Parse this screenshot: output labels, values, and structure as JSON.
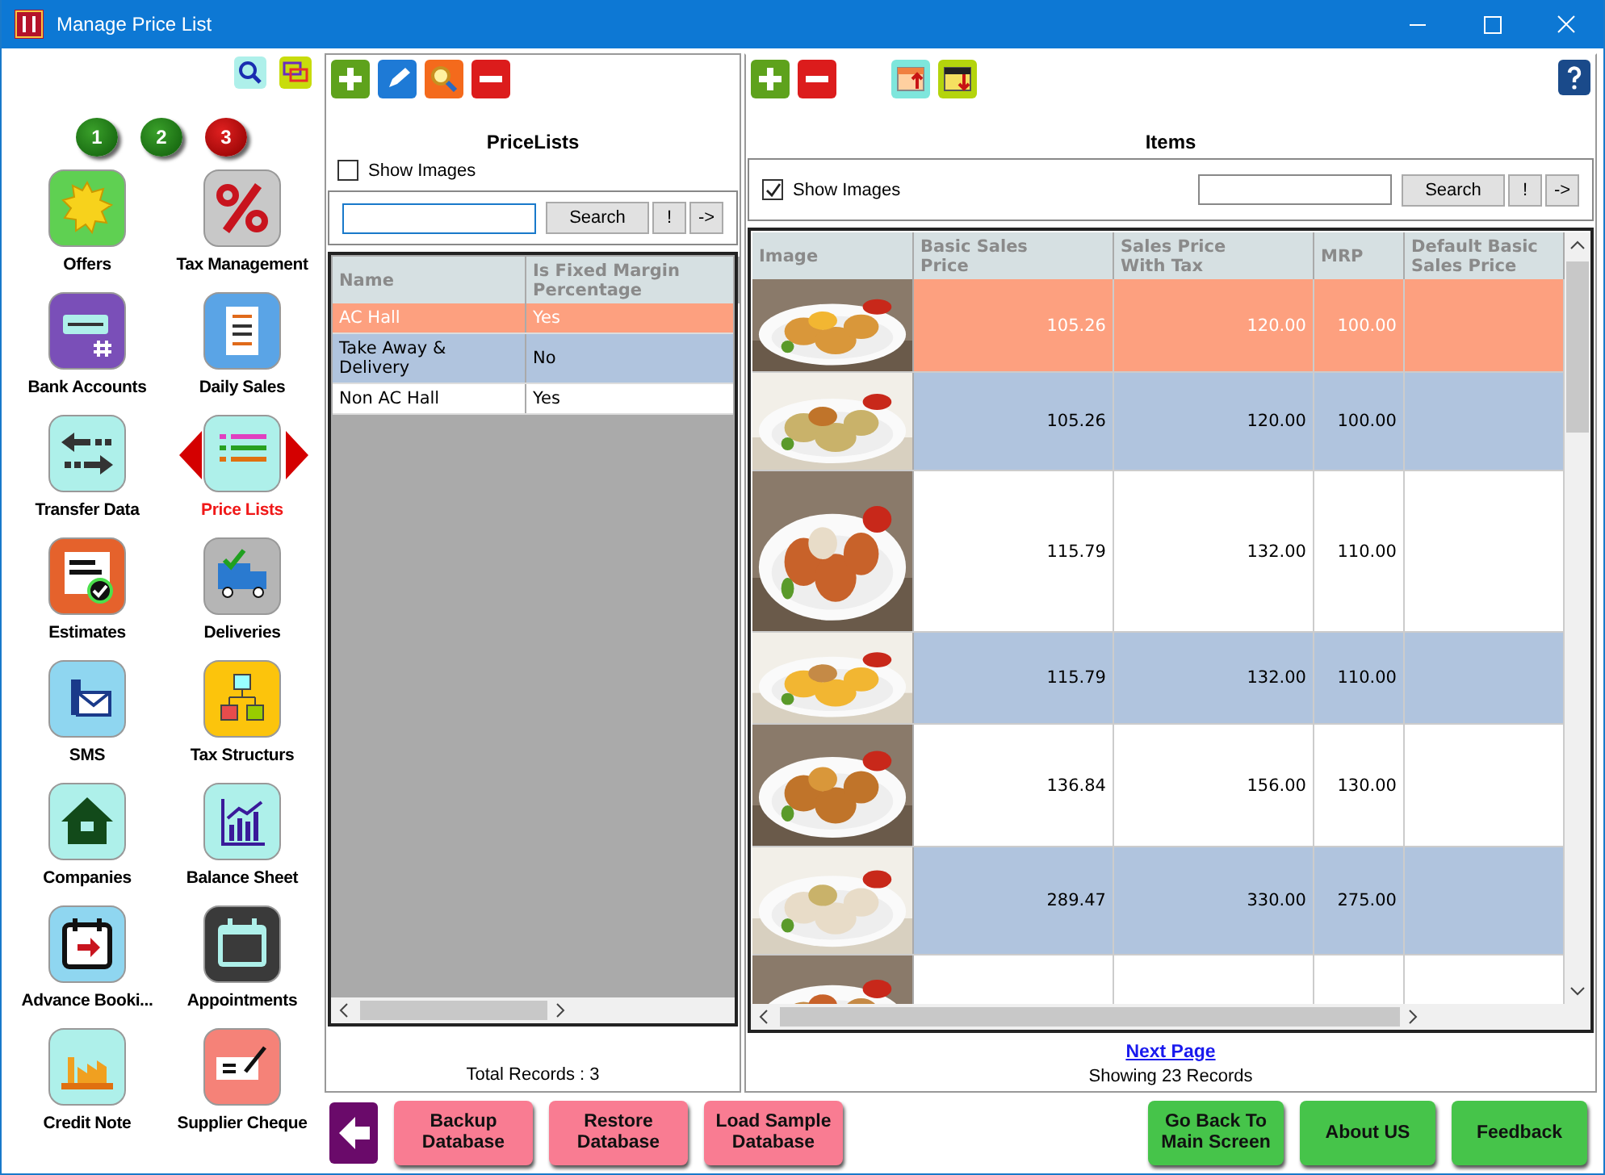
{
  "window": {
    "title": "Manage Price List"
  },
  "sidebar": {
    "pages": [
      {
        "label": "1",
        "selected": false
      },
      {
        "label": "2",
        "selected": false
      },
      {
        "label": "3",
        "selected": true
      }
    ],
    "items": [
      {
        "label": "Offers",
        "selected": false
      },
      {
        "label": "Tax Management",
        "selected": false
      },
      {
        "label": "Bank Accounts",
        "selected": false
      },
      {
        "label": "Daily Sales",
        "selected": false
      },
      {
        "label": "Transfer Data",
        "selected": false
      },
      {
        "label": "Price Lists",
        "selected": true
      },
      {
        "label": "Estimates",
        "selected": false
      },
      {
        "label": "Deliveries",
        "selected": false
      },
      {
        "label": "SMS",
        "selected": false
      },
      {
        "label": "Tax Structurs",
        "selected": false
      },
      {
        "label": "Companies",
        "selected": false
      },
      {
        "label": "Balance Sheet",
        "selected": false
      },
      {
        "label": "Advance Booki...",
        "selected": false
      },
      {
        "label": "Appointments",
        "selected": false
      },
      {
        "label": "Credit Note",
        "selected": false
      },
      {
        "label": "Supplier Cheque",
        "selected": false
      }
    ]
  },
  "price_lists": {
    "title": "PriceLists",
    "show_images": {
      "label": "Show Images",
      "checked": false
    },
    "search": {
      "button": "Search",
      "clear": "!",
      "go": "->"
    },
    "columns": [
      "Name",
      "Is Fixed Margin Percentage"
    ],
    "rows": [
      {
        "cells": [
          "AC Hall",
          "Yes"
        ],
        "selected": true
      },
      {
        "cells": [
          "Take Away & Delivery",
          "No"
        ],
        "selected": false
      },
      {
        "cells": [
          "Non AC Hall",
          "Yes"
        ],
        "selected": false
      }
    ],
    "footer": "Total Records : 3"
  },
  "items": {
    "title": "Items",
    "show_images": {
      "label": "Show Images",
      "checked": true
    },
    "search": {
      "button": "Search",
      "clear": "!",
      "go": "->"
    },
    "columns": [
      "Image",
      "Basic Sales Price",
      "Sales Price With Tax",
      "MRP",
      "Default Basic Sales Price"
    ],
    "rows": [
      {
        "kind": "picture",
        "cells": [
          "105.26",
          "120.00",
          "100.00"
        ],
        "selected": true
      },
      {
        "kind": "picture",
        "cells": [
          "105.26",
          "120.00",
          "100.00"
        ],
        "selected": false
      },
      {
        "kind": "picture",
        "cells": [
          "115.79",
          "132.00",
          "110.00"
        ],
        "selected": false
      },
      {
        "kind": "picture",
        "cells": [
          "115.79",
          "132.00",
          "110.00"
        ],
        "selected": false
      },
      {
        "kind": "picture",
        "cells": [
          "136.84",
          "156.00",
          "130.00"
        ],
        "selected": false
      },
      {
        "kind": "picture",
        "cells": [
          "289.47",
          "330.00",
          "275.00"
        ],
        "selected": false
      },
      {
        "kind": "picture",
        "selected": false
      }
    ],
    "next_page": "Next Page",
    "showing": "Showing 23 Records"
  },
  "bottom_buttons": [
    {
      "label": "Backup Database",
      "kind": "pink"
    },
    {
      "label": "Restore Database",
      "kind": "pink"
    },
    {
      "label": "Load Sample Database",
      "kind": "pink"
    },
    {
      "label": "Go Back To Main Screen",
      "kind": "green"
    },
    {
      "label": "About US",
      "kind": "green"
    },
    {
      "label": "Feedback",
      "kind": "green"
    }
  ]
}
